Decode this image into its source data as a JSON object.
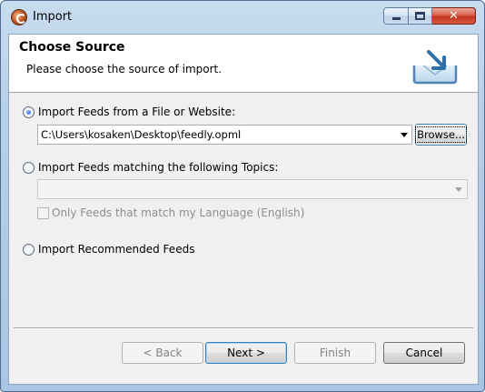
{
  "window": {
    "title": "Import",
    "app_icon": "eclipse-icon"
  },
  "banner": {
    "title": "Choose Source",
    "description": "Please choose the source of import.",
    "image_icon": "import-tray-icon"
  },
  "options": {
    "file_or_website": {
      "label": "Import Feeds from a File or Website:",
      "selected": true,
      "path_value": "C:\\Users\\kosaken\\Desktop\\feedly.opml",
      "browse_label": "Browse..."
    },
    "topics": {
      "label": "Import Feeds matching the following Topics:",
      "selected": false,
      "topic_value": "",
      "language_checkbox_label": "Only Feeds that match my Language (English)",
      "language_checked": false
    },
    "recommended": {
      "label": "Import Recommended Feeds",
      "selected": false
    }
  },
  "buttons": {
    "back": "< Back",
    "next": "Next >",
    "finish": "Finish",
    "cancel": "Cancel"
  },
  "colors": {
    "accent_focus": "#3c7fb1",
    "close_button": "#c3331b",
    "dialog_background": "#f0f0f0"
  }
}
